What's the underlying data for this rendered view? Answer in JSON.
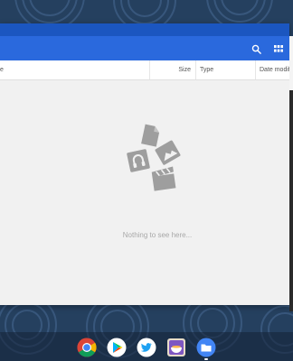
{
  "files_app": {
    "toolbar": {
      "search_icon": "search-icon",
      "view_icon": "grid-view-icon"
    },
    "columns": {
      "name": "e",
      "size": "Size",
      "type": "Type",
      "date": "Date modifi"
    },
    "empty_state": {
      "message": "Nothing to see here...",
      "illustration_icons": [
        "document-icon",
        "image-icon",
        "audio-icon",
        "video-icon"
      ]
    },
    "colors": {
      "toolbar": "#2a69dd",
      "frame": "#1b56c0",
      "background": "#f1f1f1",
      "empty_text": "#a8a8a8",
      "illustration": "#9e9e9e"
    }
  },
  "shelf": {
    "apps": [
      "chrome-icon",
      "play-store-icon",
      "twitter-icon",
      "cooking-app-icon",
      "files-app-icon"
    ],
    "active_app": "files-app-icon"
  }
}
